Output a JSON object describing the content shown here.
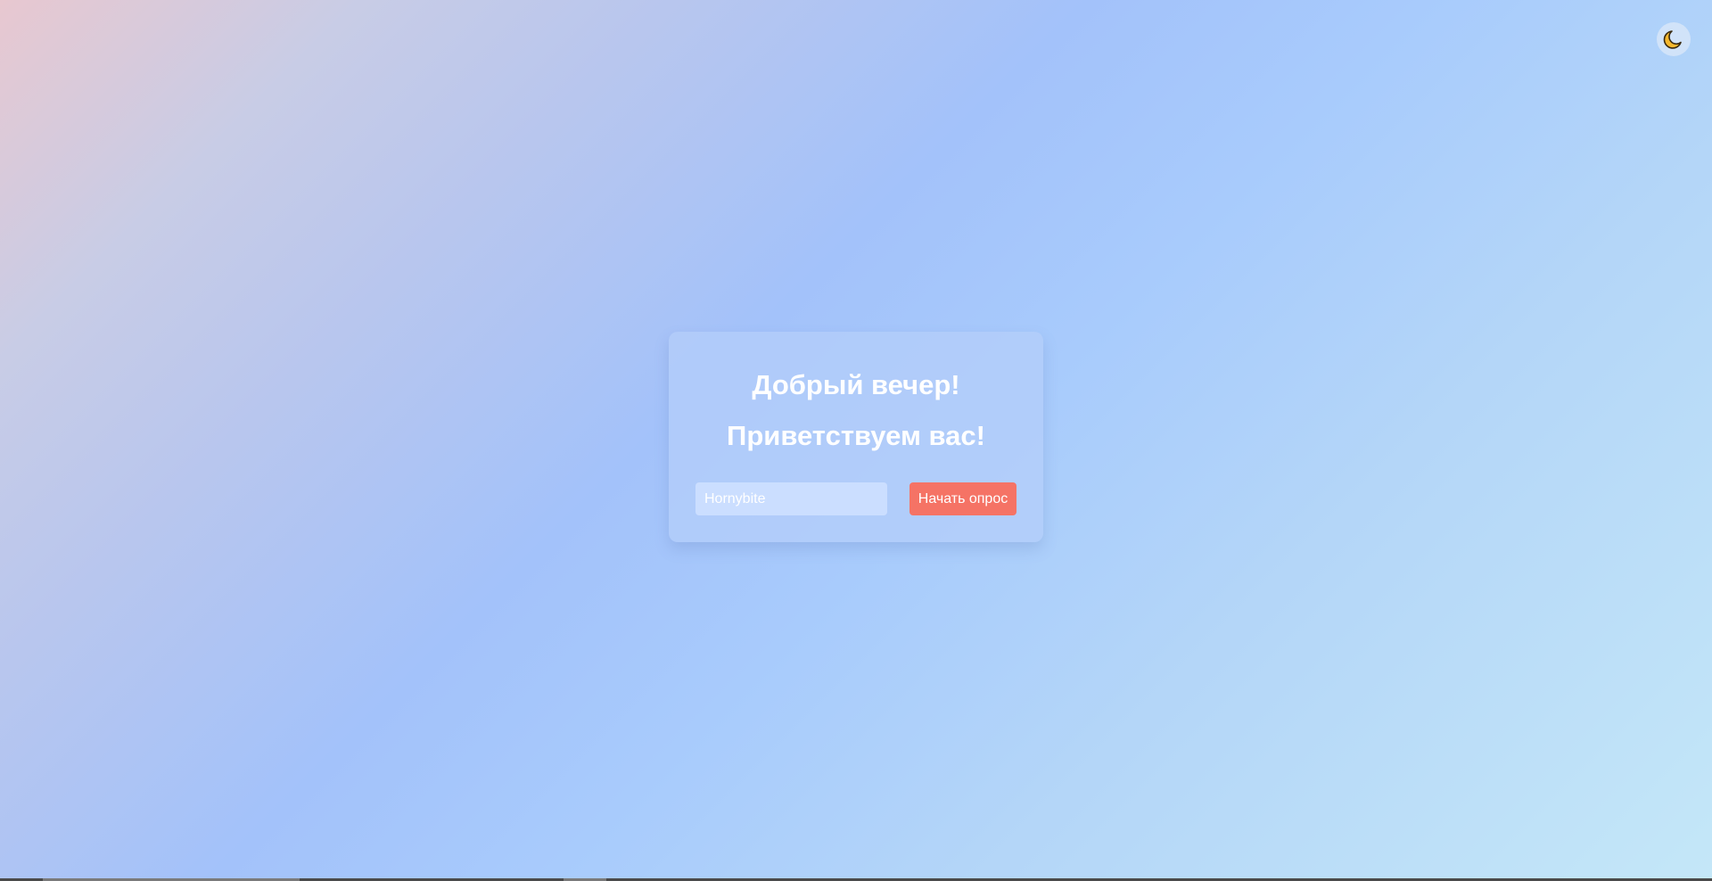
{
  "theme_toggle": {
    "icon": "crescent-moon-icon",
    "icon_color": "#f5b82e"
  },
  "card": {
    "greeting": "Добрый вечер!",
    "welcome": "Приветствуем вас!",
    "name_input": {
      "value": "Hornybite",
      "placeholder": ""
    },
    "start_button_label": "Начать опрос"
  },
  "colors": {
    "accent_button": "#f57365",
    "text": "#ffffff"
  }
}
